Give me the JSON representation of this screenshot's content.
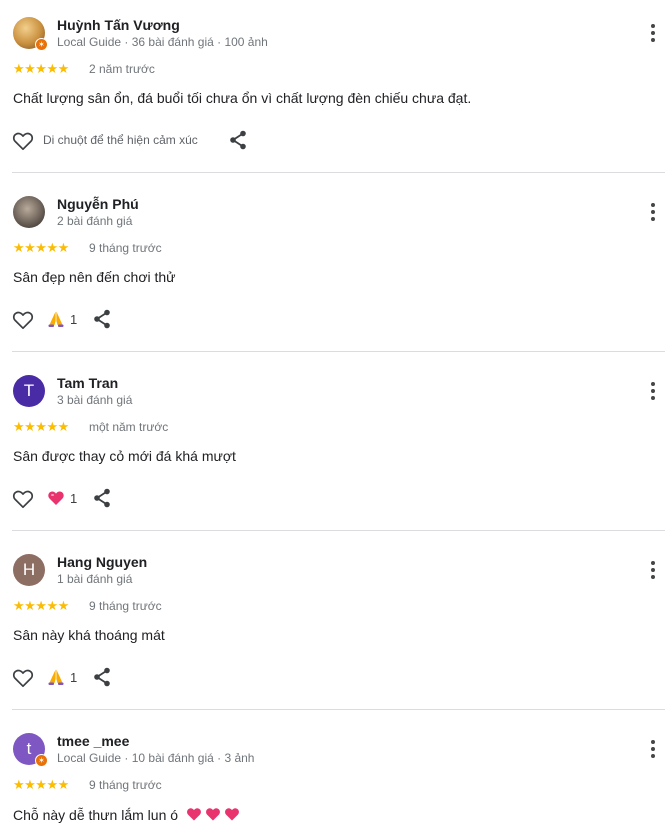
{
  "reviews": [
    {
      "name": "Huỳnh Tấn Vương",
      "meta": "Local Guide · 36 bài đánh giá · 100 ảnh",
      "avatar_letter": "",
      "stars": "★★★★★",
      "time": "2 năm trước",
      "text": "Chất lượng sân ổn, đá buổi tối chưa ổn vì chất lượng đèn chiếu chưa đạt.",
      "reaction_prompt": "Di chuột để thể hiện cảm xúc",
      "reaction_count": ""
    },
    {
      "name": "Nguyễn Phú",
      "meta": "2 bài đánh giá",
      "avatar_letter": "",
      "stars": "★★★★★",
      "time": "9 tháng trước",
      "text": "Sân đẹp nên đến chơi thử",
      "reaction_icon": "pray-icon",
      "reaction_count": "1"
    },
    {
      "name": "Tam Tran",
      "meta": "3 bài đánh giá",
      "avatar_letter": "T",
      "avatar_color": "#4a2ba6",
      "stars": "★★★★★",
      "time": "một năm trước",
      "text": "Sân được thay cỏ mới đá khá mượt",
      "reaction_icon": "heart-icon",
      "reaction_count": "1"
    },
    {
      "name": "Hang Nguyen",
      "meta": "1 bài đánh giá",
      "avatar_letter": "H",
      "avatar_color": "#8d6e63",
      "stars": "★★★★★",
      "time": "9 tháng trước",
      "text": "Sân này khá thoáng mát",
      "reaction_icon": "pray-icon",
      "reaction_count": "1"
    },
    {
      "name": "tmee _mee",
      "meta": "Local Guide · 10 bài đánh giá · 3 ảnh",
      "avatar_letter": "t",
      "avatar_color": "#7e57c2",
      "stars": "★★★★★",
      "time": "9 tháng trước",
      "text": "Chỗ này dễ thưn lắm lun ó",
      "text_emoji": "💗 💗 💗"
    }
  ],
  "colors": {
    "star": "#fbbc04",
    "meta_text": "#70757a",
    "divider": "#dadce0",
    "heart_reaction": "#e8336f",
    "pray_reaction": "#f9ab00"
  }
}
